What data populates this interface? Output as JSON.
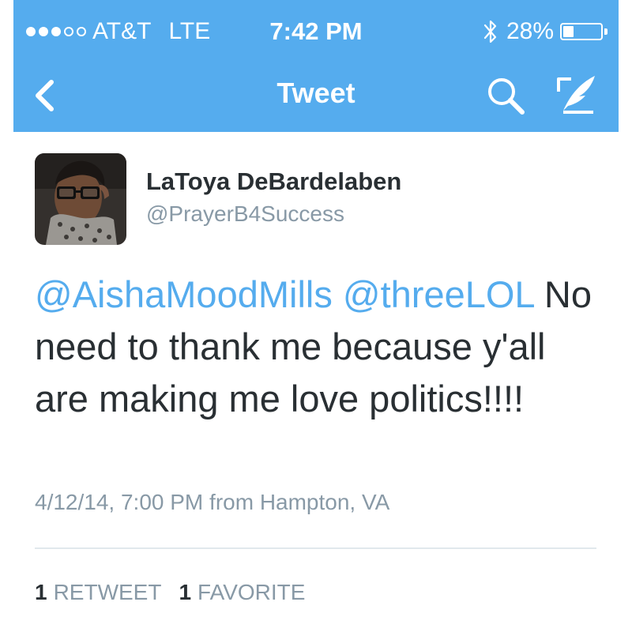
{
  "status_bar": {
    "carrier": "AT&T",
    "network": "LTE",
    "time": "7:42 PM",
    "battery_percent": "28%",
    "battery_level": 0.28,
    "signal_bars_filled": 3,
    "signal_bars_total": 5,
    "icons": [
      "signal-dots",
      "bluetooth-icon",
      "battery-icon"
    ]
  },
  "nav": {
    "title": "Tweet",
    "icons": [
      "back-chevron-icon",
      "search-icon",
      "compose-icon"
    ]
  },
  "tweet": {
    "author_name": "LaToya DeBardelaben",
    "author_handle": "@PrayerB4Success",
    "mention_1": "@AishaMoodMills",
    "mention_2": "@threeLOL",
    "body": "No need to thank me because y'all are making me love politics!!!!",
    "meta": "4/12/14, 7:00 PM from Hampton, VA",
    "retweet_count": "1",
    "retweet_label": "RETWEET",
    "favorite_count": "1",
    "favorite_label": "FAVORITE"
  },
  "colors": {
    "brand": "#55acee",
    "text": "#292f33",
    "muted": "#8899a6"
  }
}
